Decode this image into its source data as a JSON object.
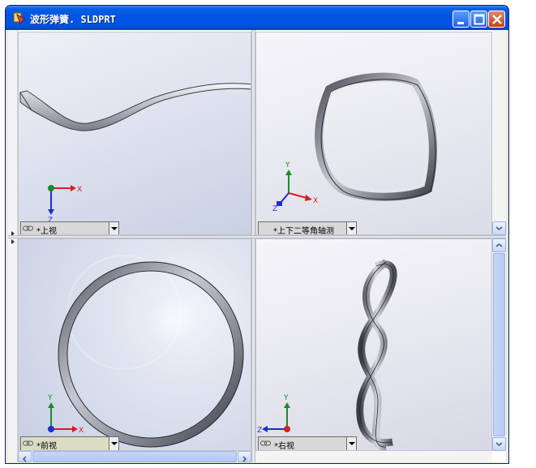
{
  "window": {
    "title": "波形弹簧. SLDPRT",
    "buttons": [
      "minimize",
      "maximize",
      "close"
    ]
  },
  "viewports": {
    "top_left": {
      "label": "*上视",
      "axes": [
        "X",
        "Z"
      ]
    },
    "top_right": {
      "label": "*上下二等角轴测",
      "axes": [
        "X",
        "Y",
        "Z"
      ]
    },
    "bottom_left": {
      "label": "*前视",
      "axes": [
        "X",
        "Y"
      ]
    },
    "bottom_right": {
      "label": "*右视",
      "axes": [
        "Y",
        "Z"
      ]
    }
  },
  "colors": {
    "axis_x": "#d42020",
    "axis_y": "#1a8a2a",
    "axis_z": "#1b2fc8",
    "titlebar": "#0054e3"
  },
  "icons": [
    "solidworks-part-icon",
    "link-icon",
    "dropdown-arrow-icon",
    "scroll-arrow-icon"
  ]
}
